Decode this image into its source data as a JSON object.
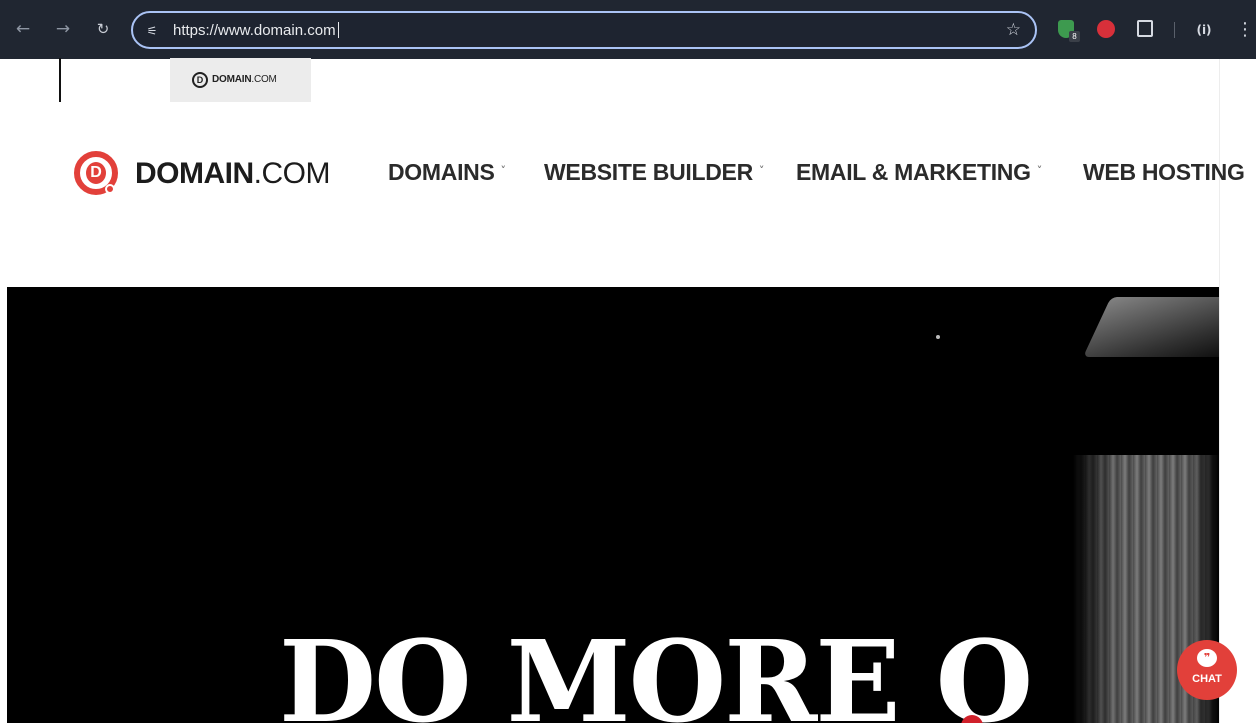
{
  "browser": {
    "url": "https://www.domain.com",
    "icons": {
      "back": "back-arrow-icon",
      "forward": "forward-arrow-icon",
      "reload": "reload-icon",
      "site_info": "site-info-icon",
      "bookmark": "star-icon",
      "menu": "kebab-menu-icon"
    },
    "extensions": [
      {
        "name": "shield-extension-icon",
        "badge": "8"
      },
      {
        "name": "red-extension-icon"
      },
      {
        "name": "puzzle-extensions-icon"
      },
      {
        "name": "profile-icon"
      }
    ]
  },
  "tooltip": {
    "logo_bold": "DOMAIN",
    "logo_light": ".COM"
  },
  "header": {
    "logo_bold": "DOMAIN",
    "logo_light": ".COM",
    "logo_letter": "D",
    "nav": [
      {
        "label": "DOMAINS",
        "has_dropdown": true
      },
      {
        "label": "WEBSITE BUILDER",
        "has_dropdown": true
      },
      {
        "label": "EMAIL & MARKETING",
        "has_dropdown": true
      },
      {
        "label": "WEB HOSTING",
        "has_dropdown": false
      }
    ]
  },
  "hero": {
    "headline": "DO MORE O"
  },
  "chat": {
    "label": "CHAT"
  },
  "colors": {
    "brand_red": "#e2403a",
    "toolbar_bg": "#202631",
    "omnibox_border": "#aac3f5",
    "hero_bg": "#000000"
  }
}
